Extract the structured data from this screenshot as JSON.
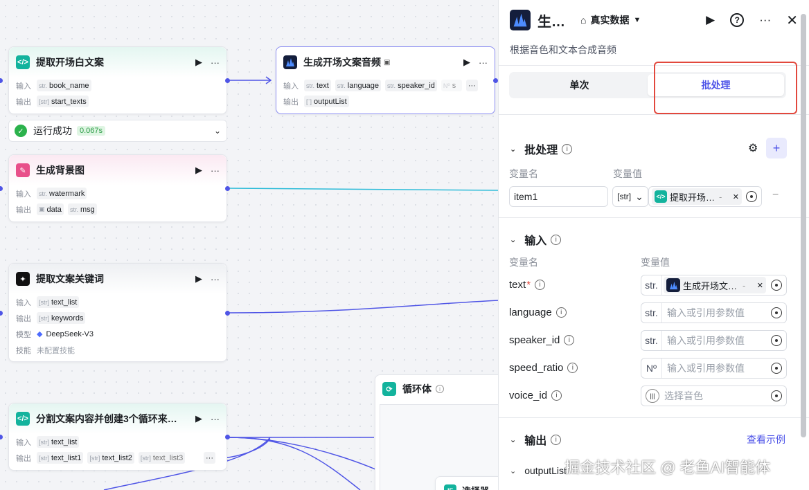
{
  "canvas": {
    "nodes": [
      {
        "title": "提取开场白文案",
        "input_label": "输入",
        "output_label": "输出",
        "inputs": [
          {
            "type": "str.",
            "name": "book_name"
          }
        ],
        "outputs": [
          {
            "type": "[str]",
            "name": "start_texts"
          }
        ]
      },
      {
        "title": "生成开场文案音频",
        "input_label": "输入",
        "output_label": "输出",
        "inputs": [
          {
            "type": "str.",
            "name": "text"
          },
          {
            "type": "str.",
            "name": "language"
          },
          {
            "type": "str.",
            "name": "speaker_id"
          },
          {
            "type": "Nº",
            "name": "s"
          }
        ],
        "outputs": [
          {
            "type": "[¨]",
            "name": "outputList"
          }
        ]
      },
      {
        "title": "生成背景图",
        "input_label": "输入",
        "output_label": "输出",
        "inputs": [
          {
            "type": "str.",
            "name": "watermark"
          }
        ],
        "outputs": [
          {
            "type": "▣",
            "name": "data"
          },
          {
            "type": "str.",
            "name": "msg"
          }
        ]
      },
      {
        "title": "提取文案关键词",
        "input_label": "输入",
        "output_label": "输出",
        "model_label": "模型",
        "skill_label": "技能",
        "inputs": [
          {
            "type": "[str]",
            "name": "text_list"
          }
        ],
        "outputs": [
          {
            "type": "[str]",
            "name": "keywords"
          }
        ],
        "model": "DeepSeek-V3",
        "skill": "未配置技能"
      },
      {
        "title": "分割文案内容并创建3个循环来…",
        "input_label": "输入",
        "output_label": "输出",
        "inputs": [
          {
            "type": "[str]",
            "name": "text_list"
          }
        ],
        "outputs": [
          {
            "type": "[str]",
            "name": "text_list1"
          },
          {
            "type": "[str]",
            "name": "text_list2"
          },
          {
            "type": "[str]",
            "name": "text_list3"
          }
        ]
      },
      {
        "title": "循环体"
      },
      {
        "title": "选择器"
      }
    ],
    "status": {
      "text": "运行成功",
      "duration": "0.067s"
    },
    "more_label": "···"
  },
  "panel": {
    "title": "生…",
    "mode": "真实数据",
    "description": "根据音色和文本合成音频",
    "tabs": [
      "单次",
      "批处理"
    ],
    "batch": {
      "title": "批处理",
      "var_name_label": "变量名",
      "var_value_label": "变量值",
      "item_name": "item1",
      "item_type": "[str]",
      "item_ref": "提取开场…",
      "item_ref_suffix": "-"
    },
    "input": {
      "title": "输入",
      "var_name_label": "变量名",
      "var_value_label": "变量值",
      "params": [
        {
          "name": "text",
          "required": true,
          "type": "str.",
          "ref": "生成开场文…",
          "ref_suffix": "-"
        },
        {
          "name": "language",
          "type": "str.",
          "placeholder": "输入或引用参数值"
        },
        {
          "name": "speaker_id",
          "type": "str.",
          "placeholder": "输入或引用参数值"
        },
        {
          "name": "speed_ratio",
          "type": "Nº",
          "placeholder": "输入或引用参数值"
        },
        {
          "name": "voice_id",
          "type": "(|||)",
          "placeholder": "选择音色"
        }
      ]
    },
    "output": {
      "title": "输出",
      "example_link": "查看示例",
      "var": "outputList"
    }
  },
  "watermark": "掘金技术社区 @ 老鱼AI智能体",
  "colors": {
    "accent": "#4d53e8",
    "edge": "#4f55e6",
    "edge_cyan": "#2bbbd8",
    "success": "#2bb24c",
    "highlight_box": "#e2483d"
  }
}
